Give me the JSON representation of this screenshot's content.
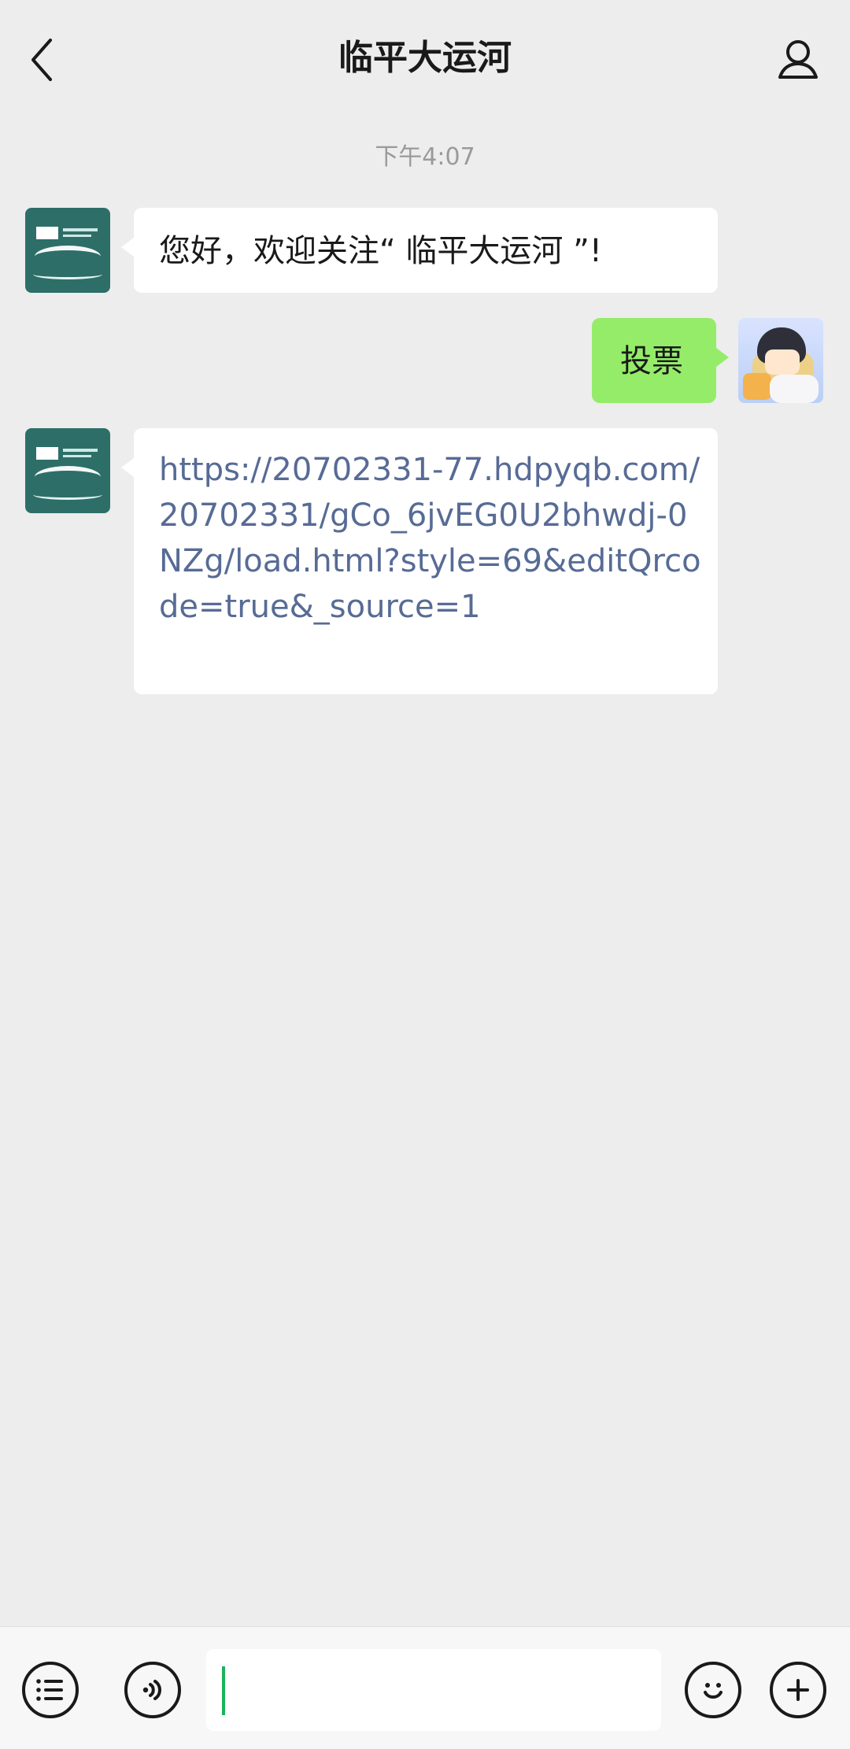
{
  "header": {
    "title": "临平大运河",
    "back_icon": "chevron-left-icon",
    "profile_icon": "person-icon"
  },
  "chat": {
    "timestamp": "下午4:07",
    "messages": [
      {
        "sender": "official",
        "text": "您好，欢迎关注“ 临平大运河 ”!"
      },
      {
        "sender": "user",
        "text": "投票"
      },
      {
        "sender": "official",
        "link": "https://20702331-77.hdpyqb.com/20702331/gCo_6jvEG0U2bhwdj-0NZg/load.html?style=69&editQrcode=true&_source=1"
      }
    ]
  },
  "composer": {
    "input_value": "",
    "menu_icon": "list-icon",
    "voice_icon": "voice-icon",
    "emoji_icon": "emoji-icon",
    "plus_icon": "plus-icon"
  },
  "colors": {
    "background": "#ededed",
    "bubble_left": "#ffffff",
    "bubble_right": "#95ec69",
    "link": "#576b95",
    "caret": "#19b35b"
  }
}
